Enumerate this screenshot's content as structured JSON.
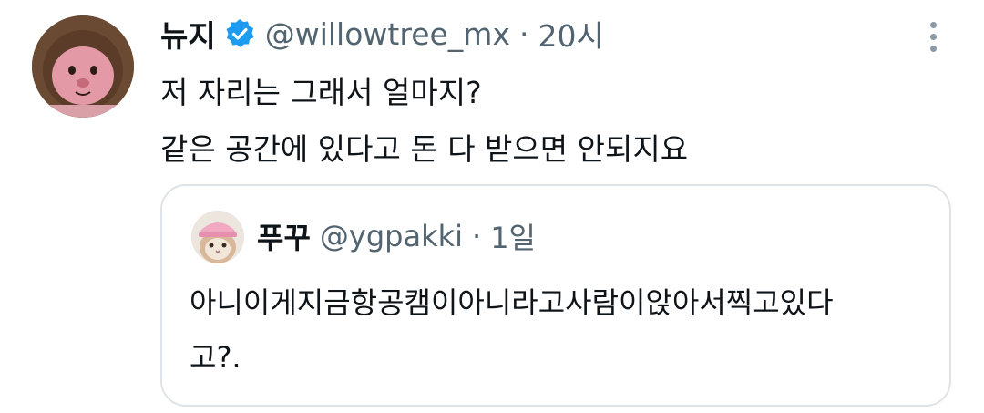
{
  "tweet": {
    "author": {
      "display_name": "뉴지",
      "handle": "@willowtree_mx",
      "verified_icon": "verified-badge-icon",
      "verified_color": "#1d9bf0"
    },
    "separator": "·",
    "time": "20시",
    "more_icon": "more-vertical-icon",
    "text_lines": [
      "저 자리는 그래서 얼마지?",
      "같은 공간에 있다고 돈 다 받으면 안되지요"
    ]
  },
  "quote": {
    "author": {
      "display_name": "푸꾸",
      "handle": "@ygpakki"
    },
    "separator": "·",
    "time": "1일",
    "text_lines": [
      "아니이게지금항공캠이아니라고사람이앉아서찍고있다",
      "고?."
    ]
  },
  "colors": {
    "text_primary": "#0f1419",
    "text_secondary": "#536471",
    "border": "#dfe3e7",
    "verified": "#1d9bf0"
  }
}
